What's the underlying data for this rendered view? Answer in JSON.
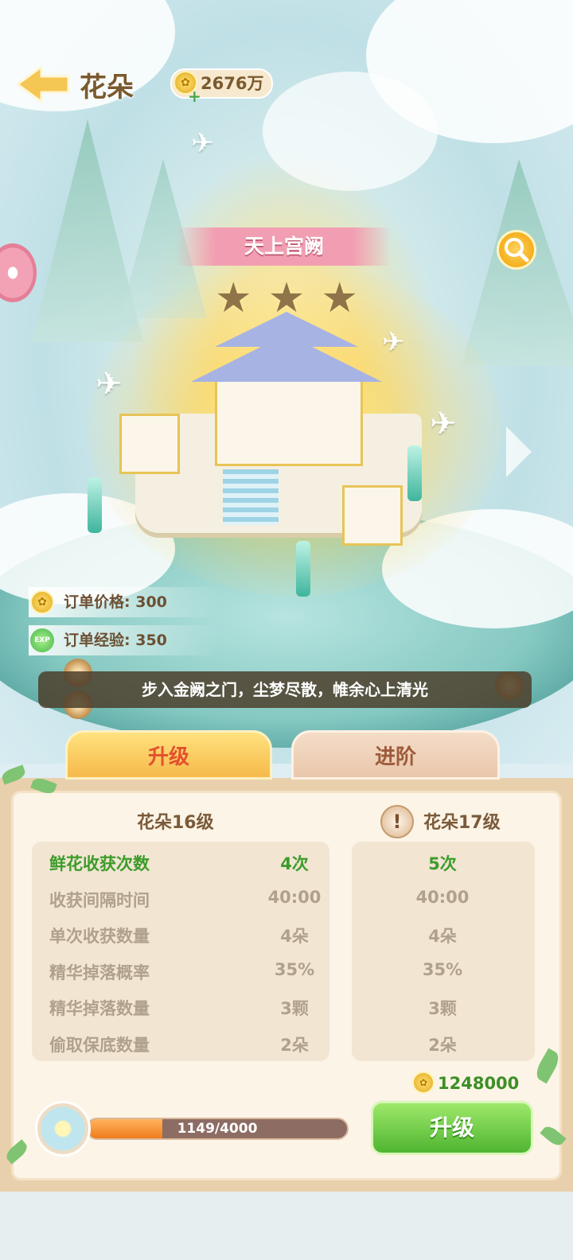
{
  "header": {
    "title": "花朵",
    "coins": "2676万"
  },
  "building": {
    "name": "天上宫阙",
    "stars_total": 3,
    "stars_filled": 0
  },
  "order_info": {
    "price_label": "订单价格:",
    "price_value": "300",
    "exp_label": "订单经验:",
    "exp_value": "350"
  },
  "slogan": "步入金阙之门，尘梦尽散，帷余心上清光",
  "tabs": {
    "upgrade": "升级",
    "advance": "进阶"
  },
  "levels": {
    "current": "花朵16级",
    "next": "花朵17级"
  },
  "stats": [
    {
      "label": "鲜花收获次数",
      "current": "4次",
      "next": "5次",
      "highlight": true
    },
    {
      "label": "收获间隔时间",
      "current": "40:00",
      "next": "40:00",
      "highlight": false
    },
    {
      "label": "单次收获数量",
      "current": "4朵",
      "next": "4朵",
      "highlight": false
    },
    {
      "label": "精华掉落概率",
      "current": "35%",
      "next": "35%",
      "highlight": false
    },
    {
      "label": "精华掉落数量",
      "current": "3颗",
      "next": "3颗",
      "highlight": false
    },
    {
      "label": "偷取保底数量",
      "current": "2朵",
      "next": "2朵",
      "highlight": false
    }
  ],
  "upgrade": {
    "cost": "1248000",
    "progress_text": "1149/4000",
    "progress_fraction": 0.287,
    "button_label": "升级"
  },
  "icons": {
    "back": "back-arrow-icon",
    "coin": "gold-coin-icon",
    "search": "magnifier-icon",
    "star": "star-icon",
    "exp": "exp-orb-icon",
    "warning": "exclamation-icon",
    "next": "chevron-right-icon"
  },
  "colors": {
    "accent_green": "#3c9c2a",
    "tab_active_text": "#e2502f",
    "banner_pink": "#f29eb2",
    "button_green": "#4fb531"
  }
}
